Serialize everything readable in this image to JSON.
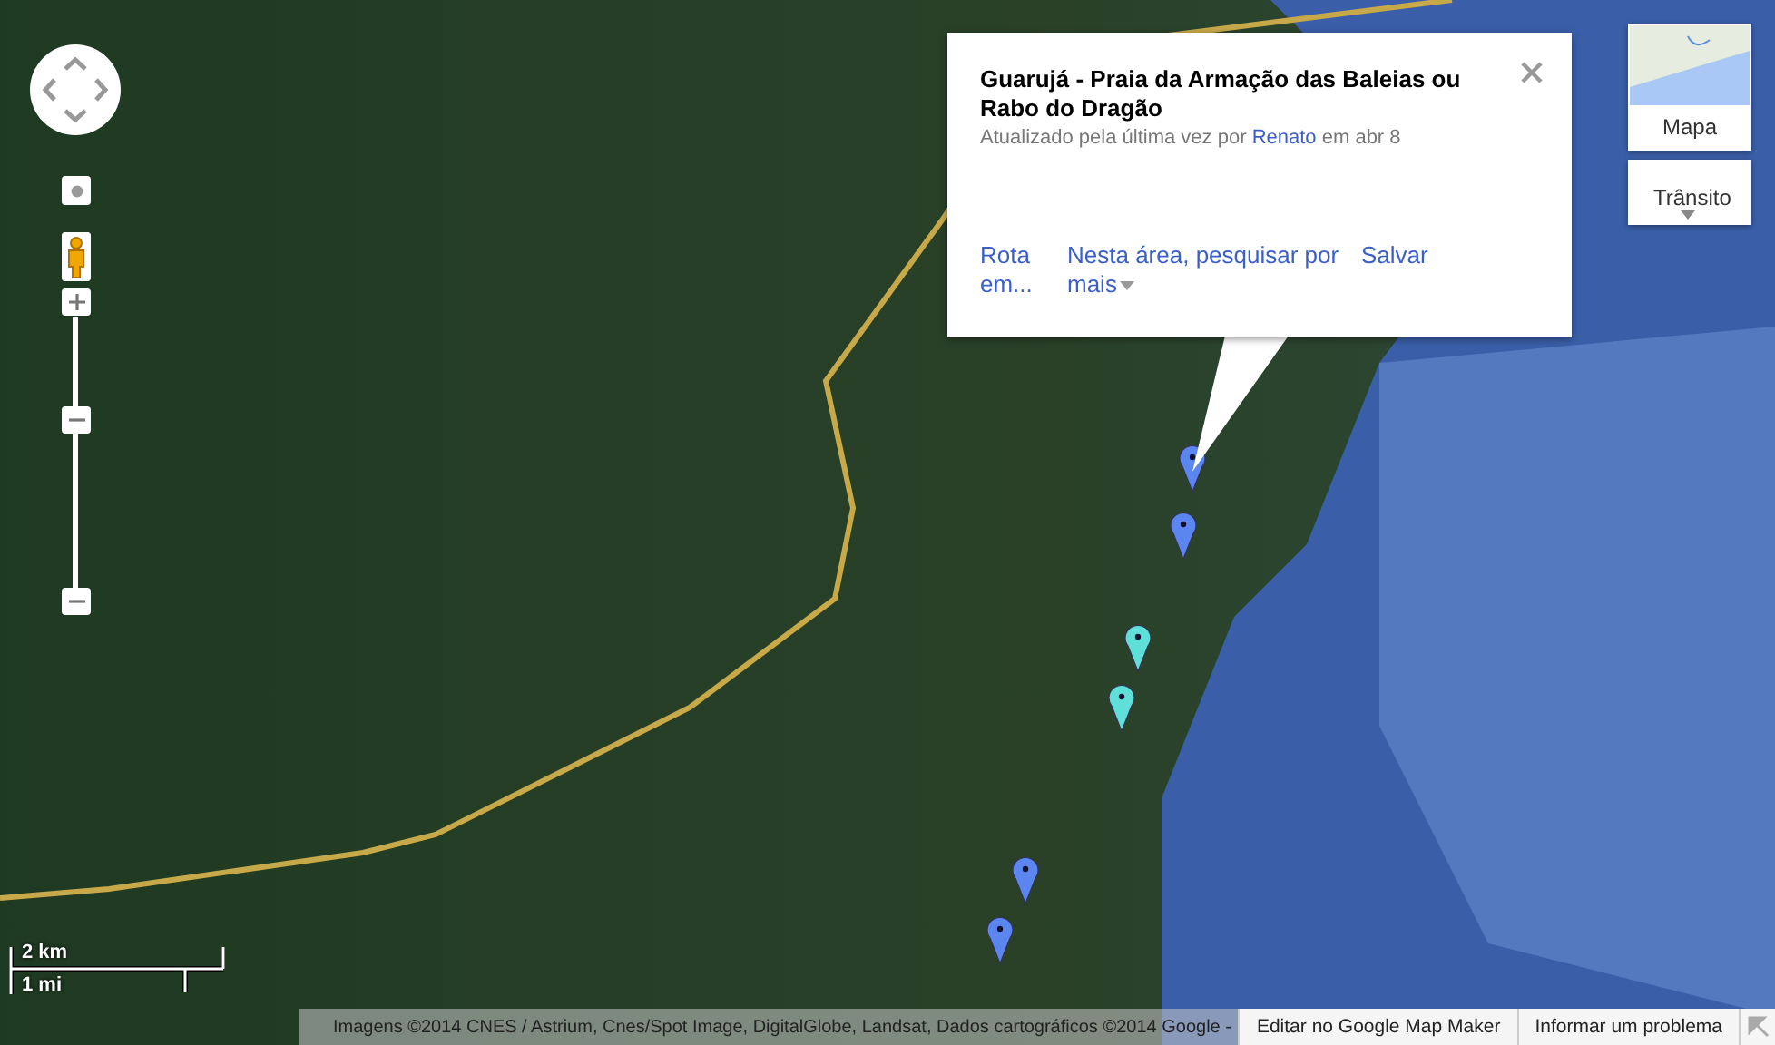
{
  "info_window": {
    "title": "Guarujá - Praia da Armação das Baleias ou Rabo do Dragão",
    "updated_prefix": "Atualizado pela última vez por",
    "author": "Renato",
    "updated_suffix": "em abr 8",
    "actions": [
      {
        "label": "Rota em..."
      },
      {
        "label": "Nesta área, pesquisar por mais",
        "dropdown": true
      },
      {
        "label": "Salvar"
      }
    ]
  },
  "map_type": {
    "label": "Mapa"
  },
  "traffic": {
    "label": "Trânsito"
  },
  "markers": [
    {
      "color": "#5b86f0"
    },
    {
      "color": "#5b86f0"
    },
    {
      "color": "#5ee0d8"
    },
    {
      "color": "#5ee0d8"
    },
    {
      "color": "#5b86f0"
    },
    {
      "color": "#5b86f0"
    }
  ],
  "scale": {
    "metric": "2 km",
    "imperial": "1 mi"
  },
  "attribution": "Imagens ©2014 CNES / Astrium, Cnes/Spot Image, DigitalGlobe, Landsat, Dados cartográficos ©2014 Google -",
  "footer_links": [
    {
      "label": "Editar no Google Map Maker"
    },
    {
      "label": "Informar um problema"
    }
  ]
}
